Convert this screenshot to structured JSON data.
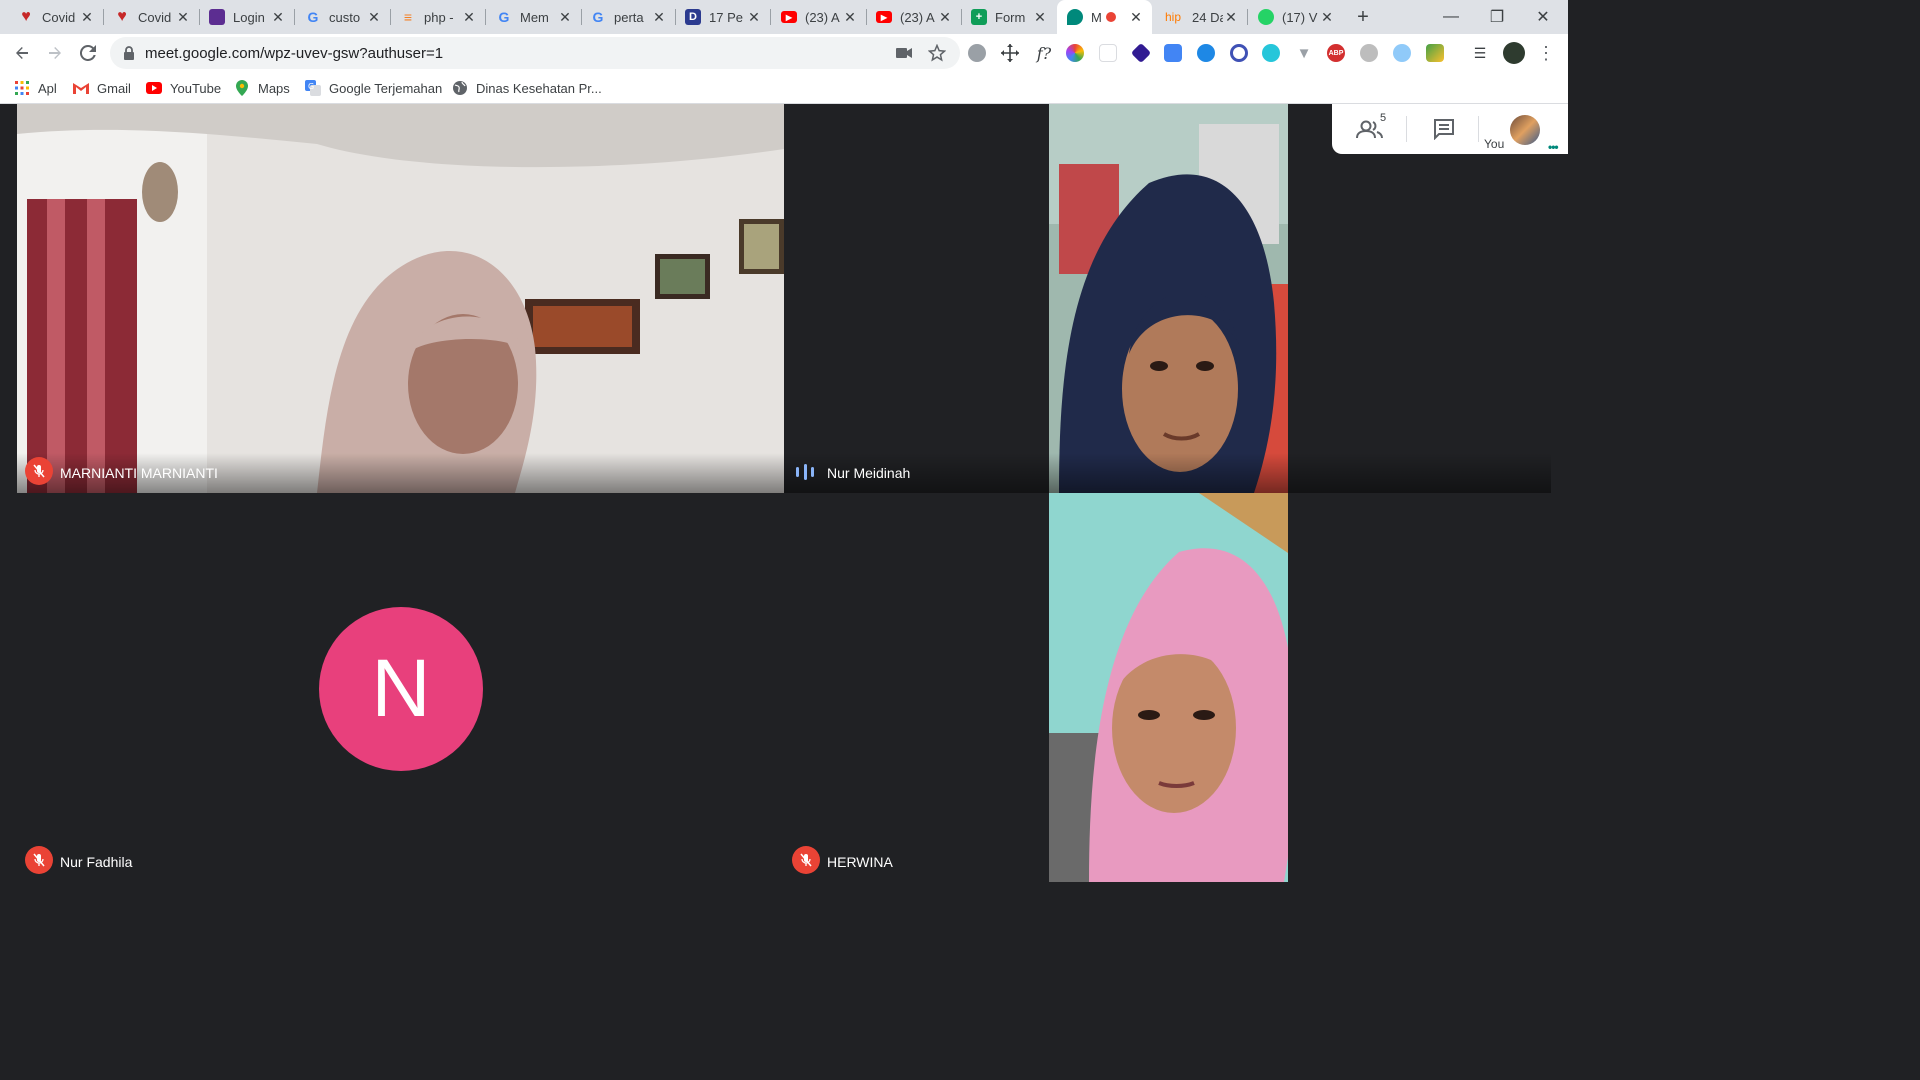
{
  "tabs": [
    {
      "title": "Covid",
      "fav": "heart",
      "color": "#c62828"
    },
    {
      "title": "Covid",
      "fav": "heart",
      "color": "#c62828"
    },
    {
      "title": "Login",
      "fav": "colorlib",
      "color": "#5c2d91"
    },
    {
      "title": "custo",
      "fav": "google",
      "color": "#4285f4"
    },
    {
      "title": "php -",
      "fav": "stack",
      "color": "#f48024"
    },
    {
      "title": "Mem",
      "fav": "google",
      "color": "#4285f4"
    },
    {
      "title": "perta",
      "fav": "google",
      "color": "#4285f4"
    },
    {
      "title": "17 Pe",
      "fav": "D",
      "color": "#2b3a8f"
    },
    {
      "title": "(23) A",
      "fav": "youtube",
      "color": "#ff0000"
    },
    {
      "title": "(23) A",
      "fav": "youtube",
      "color": "#ff0000"
    },
    {
      "title": "Form",
      "fav": "forms",
      "color": "#0f9d58"
    },
    {
      "title": "M",
      "fav": "meet",
      "color": "#00897b",
      "active": true
    },
    {
      "title": "24 Da",
      "fav": "hip",
      "color": "#ff7a00"
    },
    {
      "title": "(17) V",
      "fav": "whatsapp",
      "color": "#25d366"
    }
  ],
  "new_tab_label": "+",
  "address": {
    "url": "meet.google.com/wpz-uvev-gsw?authuser=1"
  },
  "bookmarks": [
    {
      "label": "Apl",
      "icon": "apps-icon"
    },
    {
      "label": "Gmail",
      "icon": "gmail-icon"
    },
    {
      "label": "YouTube",
      "icon": "youtube-icon"
    },
    {
      "label": "Maps",
      "icon": "maps-icon"
    },
    {
      "label": "Google Terjemahan",
      "icon": "translate-icon"
    },
    {
      "label": "Dinas Kesehatan Pr...",
      "icon": "globe-icon"
    }
  ],
  "meet": {
    "participant_count": "5",
    "you_label": "You",
    "avatar_letter": "N",
    "participants": [
      {
        "name": "MARNIANTI MARNIANTI",
        "muted": true,
        "video": true
      },
      {
        "name": "Nur Meidinah",
        "muted": false,
        "speaking": true,
        "video": true
      },
      {
        "name": "Nur Fadhila",
        "muted": true,
        "video": false
      },
      {
        "name": "HERWINA",
        "muted": true,
        "video": true
      }
    ]
  },
  "colors": {
    "meet_bg": "#202124",
    "avatar": "#e8407c",
    "mute": "#ea4335",
    "speaking": "#8ab4f8"
  }
}
